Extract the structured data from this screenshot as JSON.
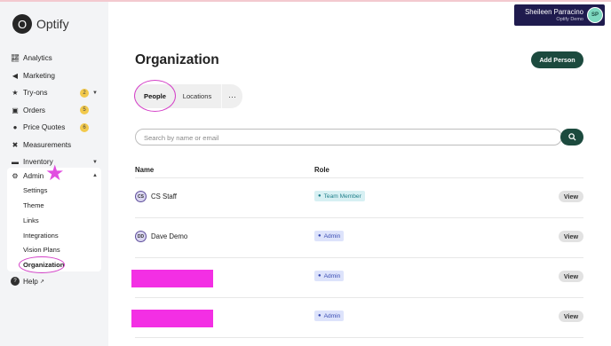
{
  "app": {
    "name": "Optify",
    "logo_letter": "O"
  },
  "user": {
    "name": "Sheileen Parracino",
    "org": "Optify Demo",
    "initials": "SP"
  },
  "sidebar": {
    "items": [
      {
        "label": "Analytics",
        "icon": "chart-icon"
      },
      {
        "label": "Marketing",
        "icon": "megaphone-icon"
      },
      {
        "label": "Try-ons",
        "icon": "star-icon",
        "badge": "2",
        "caret": true
      },
      {
        "label": "Orders",
        "icon": "box-icon",
        "badge": "5"
      },
      {
        "label": "Price Quotes",
        "icon": "dollar-icon",
        "badge": "6"
      },
      {
        "label": "Measurements",
        "icon": "ruler-icon"
      },
      {
        "label": "Inventory",
        "icon": "inventory-icon",
        "caret": true
      }
    ],
    "admin": {
      "label": "Admin",
      "subitems": [
        "Settings",
        "Theme",
        "Links",
        "Integrations",
        "Vision Plans",
        "Organization"
      ]
    },
    "help": "Help"
  },
  "page": {
    "title": "Organization",
    "add_button": "Add Person",
    "tabs": [
      "People",
      "Locations"
    ],
    "tab_more": "···",
    "active_tab": "People",
    "search_placeholder": "Search by name or email"
  },
  "table": {
    "headers": {
      "name": "Name",
      "role": "Role"
    },
    "view_label": "View",
    "rows": [
      {
        "initials": "CS",
        "name": "CS Staff",
        "role": "Team Member"
      },
      {
        "initials": "DD",
        "name": "Dave Demo",
        "role": "Admin"
      },
      {
        "initials": "",
        "name": "",
        "role": "Admin"
      },
      {
        "initials": "",
        "name": "",
        "role": "Admin"
      }
    ]
  },
  "colors": {
    "accent": "#1c4a3e",
    "user_bar": "#1f1b4e",
    "highlight": "#d441c8",
    "redaction": "#f32fe4"
  }
}
